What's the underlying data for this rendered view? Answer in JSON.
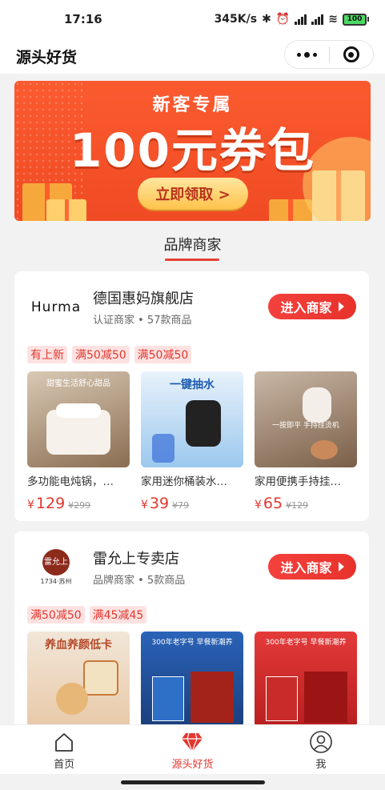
{
  "status_bar": {
    "time": "17:16",
    "network_speed": "345K/s",
    "battery": "100"
  },
  "nav": {
    "title": "源头好货"
  },
  "banner": {
    "subtitle": "新客专属",
    "title": "100元券包",
    "button": "立即领取 >"
  },
  "section": {
    "title": "品牌商家"
  },
  "stores": [
    {
      "logo_text": "Hurma",
      "name": "德国惠妈旗舰店",
      "meta": "认证商家 • 57款商品",
      "enter_label": "进入商家",
      "tags": [
        "有上新",
        "满50减50",
        "满50减50"
      ],
      "products": [
        {
          "name": "多功能电炖锅，…",
          "currency": "¥",
          "price": "129",
          "old_price": "¥299",
          "img_caption": "甜蜜生活舒心甜品"
        },
        {
          "name": "家用迷你桶装水…",
          "currency": "¥",
          "price": "39",
          "old_price": "¥79",
          "img_caption": "一键抽水"
        },
        {
          "name": "家用便携手持挂…",
          "currency": "¥",
          "price": "65",
          "old_price": "¥129",
          "img_caption": "一按即平 手持挂烫机"
        }
      ]
    },
    {
      "logo_text": "雷允上",
      "logo_sub": "1734·苏州",
      "name": "雷允上专卖店",
      "meta": "品牌商家 • 5款商品",
      "enter_label": "进入商家",
      "tags": [
        "满50减50",
        "满45减45"
      ],
      "products": [
        {
          "img_caption": "养血养颜低卡"
        },
        {
          "img_caption": "300年老字号 早餐新潮养"
        },
        {
          "img_caption": "300年老字号 早餐新潮养"
        }
      ]
    }
  ],
  "tabbar": {
    "items": [
      {
        "label": "首页",
        "icon": "home-icon"
      },
      {
        "label": "源头好货",
        "icon": "diamond-icon"
      },
      {
        "label": "我",
        "icon": "user-icon"
      }
    ]
  },
  "colors": {
    "accent": "#e2372f",
    "banner": "#f04b24"
  }
}
